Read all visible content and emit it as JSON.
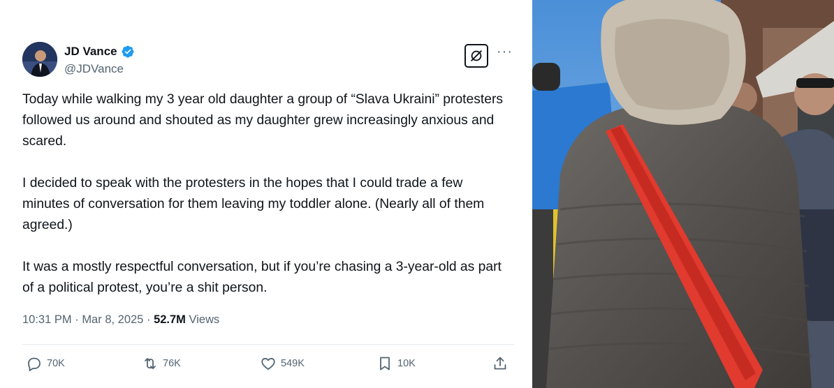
{
  "author": {
    "name": "JD Vance",
    "handle": "@JDVance",
    "verified_color": "#1d9bf0"
  },
  "tweet": {
    "paragraphs": [
      "Today while walking my 3 year old daughter a group of “Slava Ukraini” protesters followed us around and shouted as my daughter grew increasingly anxious and scared.",
      "I decided to speak with the protesters in the hopes that I could trade a few minutes of conversation for them leaving my toddler alone. (Nearly all of them agreed.)",
      "It was a mostly respectful conversation,  but if you’re chasing a 3-year-old as part of a political protest, you’re a shit person."
    ],
    "time": "10:31 PM",
    "date": "Mar 8, 2025",
    "views_count": "52.7M",
    "views_label": "Views"
  },
  "actions": {
    "replies": "70K",
    "reposts": "76K",
    "likes": "549K",
    "bookmarks": "10K"
  },
  "icons": [
    "grok-icon",
    "more-icon",
    "reply-icon",
    "repost-icon",
    "like-icon",
    "bookmark-icon",
    "share-icon",
    "verified-badge-icon"
  ]
}
